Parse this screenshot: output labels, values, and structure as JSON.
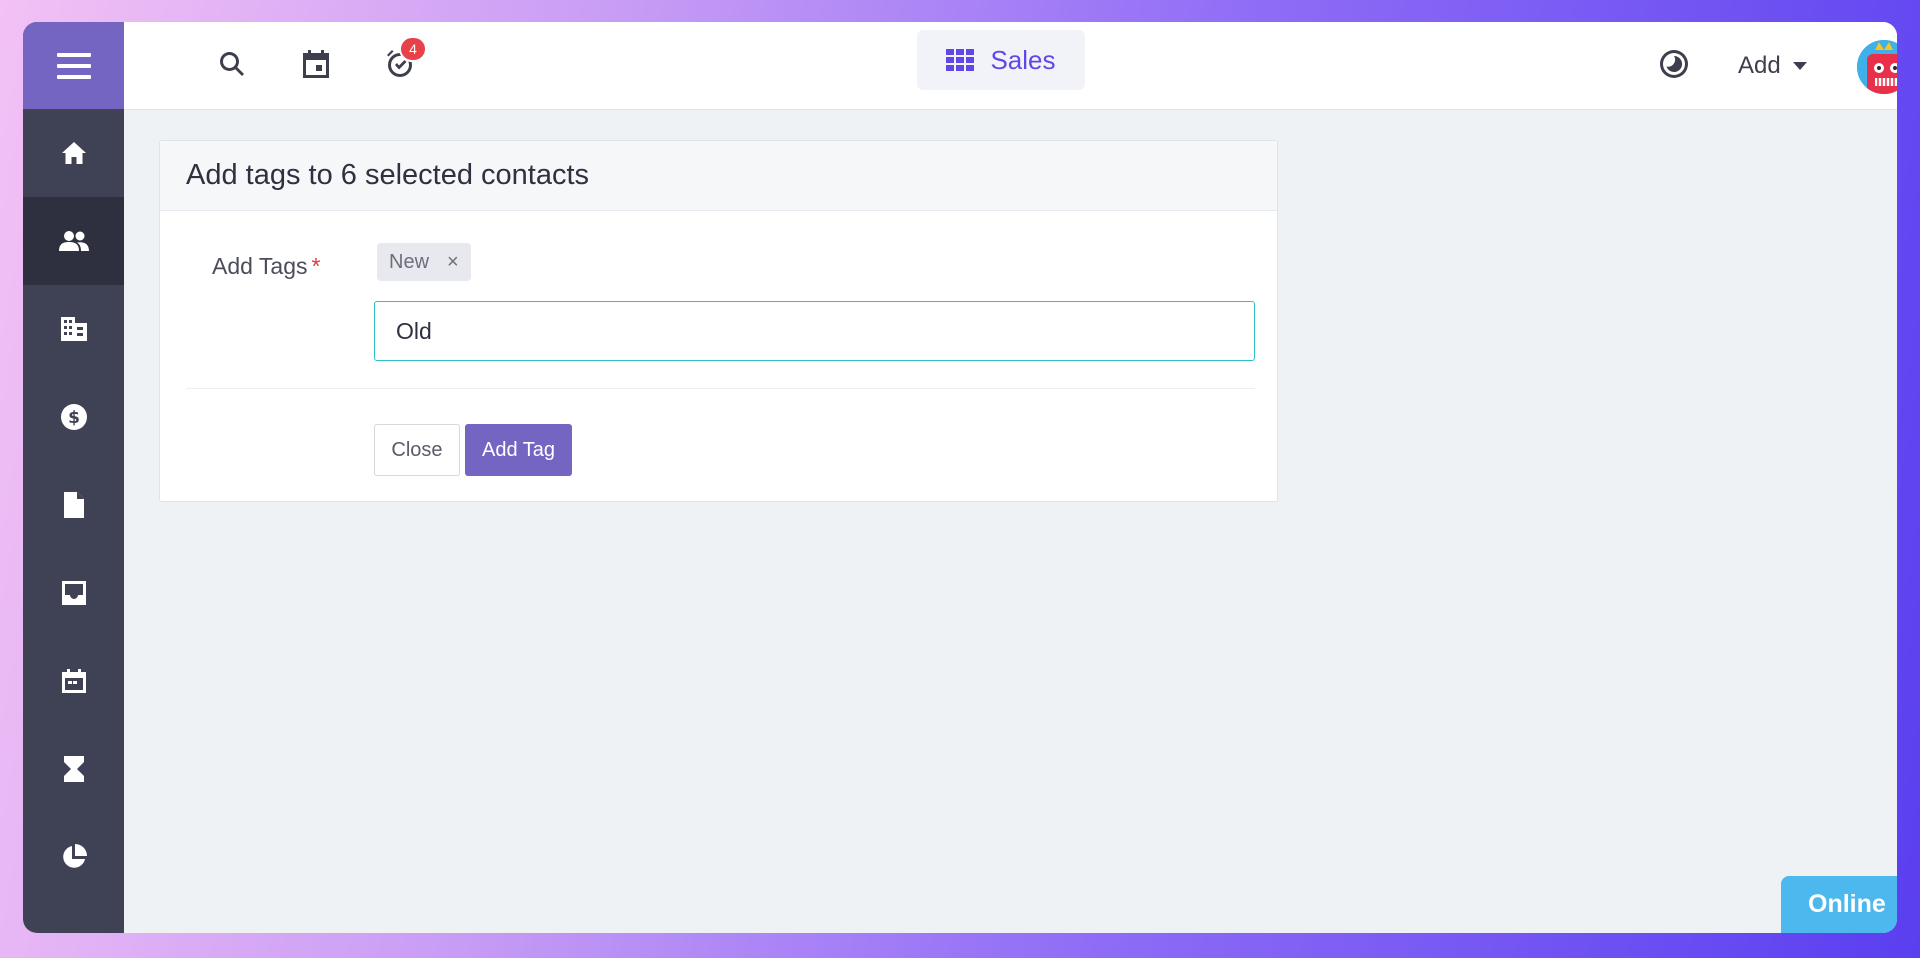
{
  "sidebar": {
    "items": [
      {
        "name": "home-icon"
      },
      {
        "name": "contacts-icon",
        "active": true
      },
      {
        "name": "building-icon"
      },
      {
        "name": "dollar-icon"
      },
      {
        "name": "document-icon"
      },
      {
        "name": "inbox-icon"
      },
      {
        "name": "calendar-icon"
      },
      {
        "name": "hourglass-icon"
      },
      {
        "name": "pie-chart-icon"
      },
      {
        "name": "gear-icon"
      }
    ]
  },
  "topbar": {
    "reminder_count": "4",
    "app_switcher_label": "Sales",
    "add_label": "Add"
  },
  "modal": {
    "title": "Add tags to 6 selected contacts",
    "field_label": "Add Tags",
    "required_mark": "*",
    "existing_tag": "New",
    "remove_symbol": "×",
    "input_value": "Old",
    "close_label": "Close",
    "submit_label": "Add Tag"
  },
  "status": {
    "online_label": "Online"
  },
  "colors": {
    "accent": "#7465c3",
    "sales_blue": "#5f49e6",
    "input_border": "#2fc0cc",
    "badge_red": "#e7414a",
    "online_blue": "#4db8ee"
  }
}
